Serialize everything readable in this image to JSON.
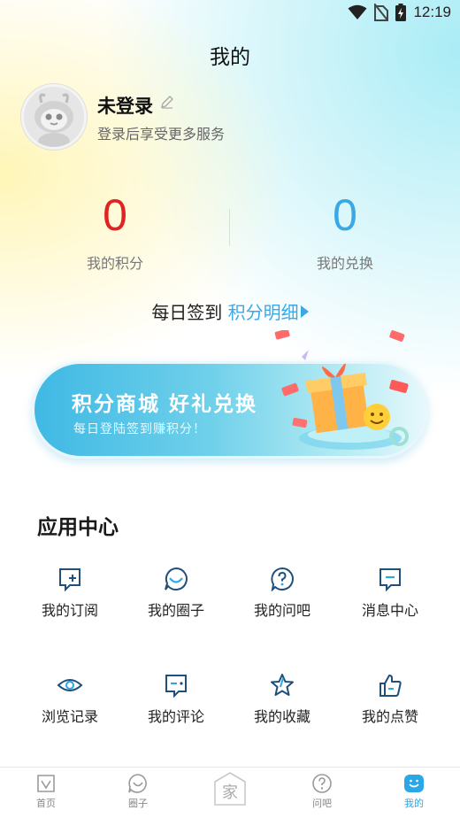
{
  "status_bar": {
    "time": "12:19"
  },
  "header": {
    "title": "我的"
  },
  "profile": {
    "name": "未登录",
    "subtitle": "登录后享受更多服务"
  },
  "stats": {
    "points": {
      "value": "0",
      "label": "我的积分",
      "color": "#e02424"
    },
    "exchange": {
      "value": "0",
      "label": "我的兑换",
      "color": "#3ba8e6"
    }
  },
  "checkin": {
    "label": "每日签到",
    "link": "积分明细"
  },
  "banner": {
    "title": "积分商城 好礼兑换",
    "subtitle": "每日登陆签到赚积分！"
  },
  "app_center": {
    "title": "应用中心",
    "items": [
      {
        "label": "我的订阅",
        "icon": "subscribe-icon"
      },
      {
        "label": "我的圈子",
        "icon": "circle-chat-icon"
      },
      {
        "label": "我的问吧",
        "icon": "question-icon"
      },
      {
        "label": "消息中心",
        "icon": "message-icon"
      },
      {
        "label": "浏览记录",
        "icon": "eye-icon"
      },
      {
        "label": "我的评论",
        "icon": "comment-icon"
      },
      {
        "label": "我的收藏",
        "icon": "star-icon"
      },
      {
        "label": "我的点赞",
        "icon": "thumbs-up-icon"
      }
    ]
  },
  "tab_bar": {
    "items": [
      {
        "label": "首页",
        "icon": "home-icon"
      },
      {
        "label": "圈子",
        "icon": "circle-icon"
      },
      {
        "label": "家",
        "icon": "home-logo-icon"
      },
      {
        "label": "问吧",
        "icon": "question-icon"
      },
      {
        "label": "我的",
        "icon": "me-icon",
        "active": true
      }
    ]
  },
  "colors": {
    "accent": "#3ba8e6",
    "icon_stroke": "#1f4f7a"
  }
}
